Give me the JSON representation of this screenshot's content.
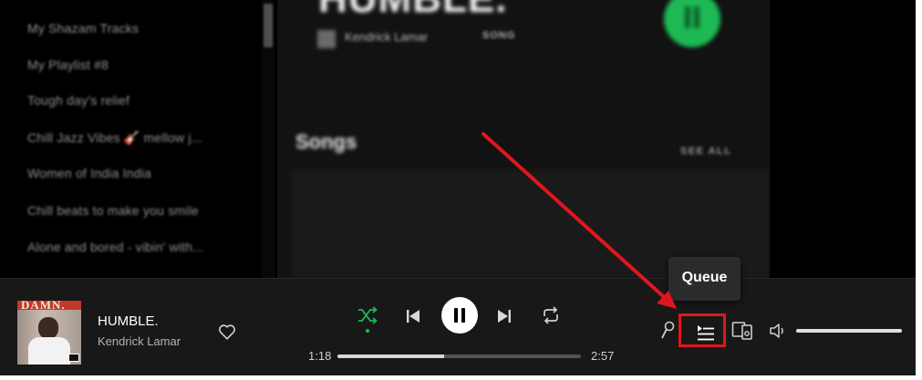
{
  "sidebar": {
    "playlists": [
      "My Shazam Tracks",
      "My Playlist #8",
      "Tough day's relief",
      "Chill Jazz Vibes 🎸 mellow j...",
      "Women of India India",
      "Chill beats to make you smile",
      "Alone and bored - vibin' with..."
    ]
  },
  "main": {
    "title": "HUMBLE.",
    "artist": "Kendrick Lamar",
    "type_label": "SONG",
    "section_title": "Songs",
    "see_all": "SEE ALL"
  },
  "player": {
    "album_word": "DAMN.",
    "track_title": "HUMBLE.",
    "track_artist": "Kendrick Lamar",
    "time_current": "1:18",
    "time_total": "2:57",
    "progress_fraction": 0.44,
    "volume_fraction": 1.0,
    "shuffle_active": true
  },
  "tooltip": {
    "text": "Queue"
  },
  "colors": {
    "accent": "#1db954",
    "player_bg": "#181818",
    "annotation": "#e0161f"
  },
  "icons": {
    "heart": "heart-icon",
    "shuffle": "shuffle-icon",
    "previous": "skip-back-icon",
    "pause": "pause-icon",
    "next": "skip-forward-icon",
    "repeat": "repeat-icon",
    "lyrics": "microphone-icon",
    "queue": "queue-icon",
    "devices": "devices-icon",
    "volume": "volume-icon"
  }
}
